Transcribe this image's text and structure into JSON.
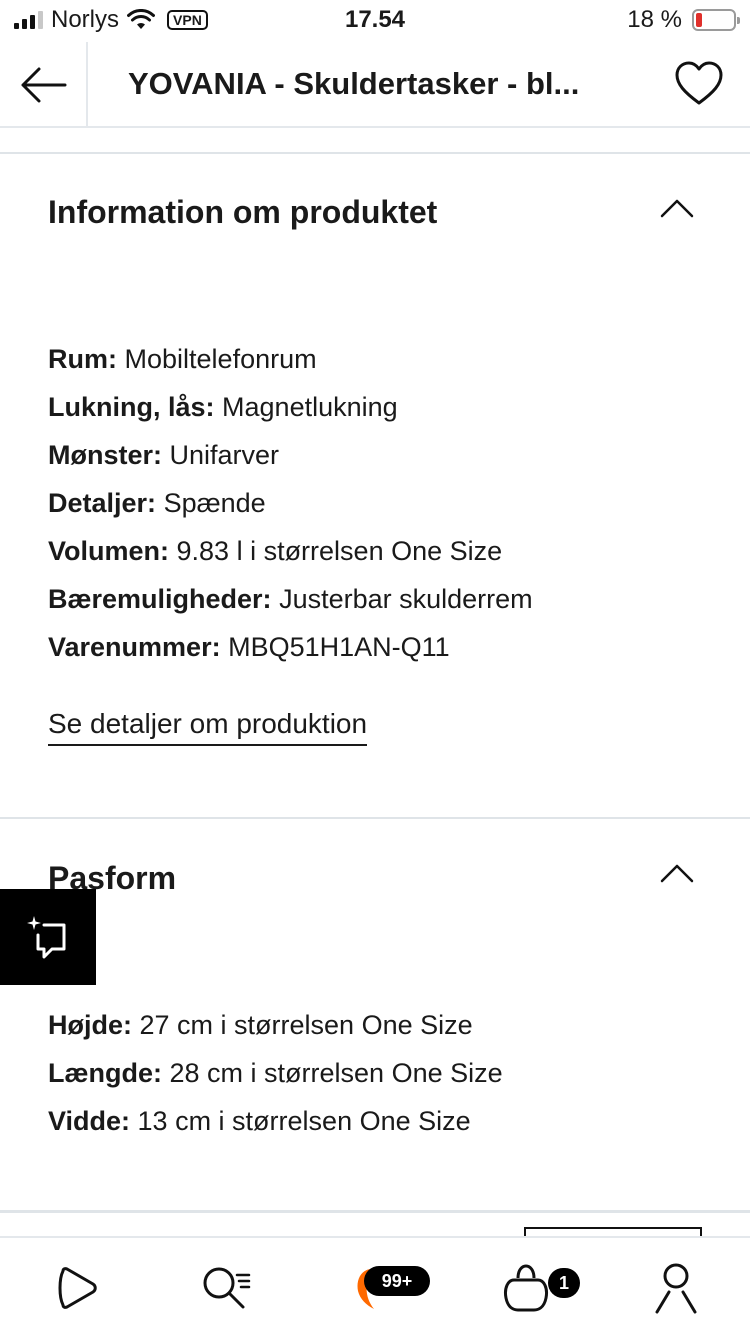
{
  "status_bar": {
    "carrier": "Norlys",
    "vpn": "VPN",
    "time": "17.54",
    "battery_percent": "18 %",
    "battery_level": 0.18,
    "battery_color": "#e0302b"
  },
  "header": {
    "title": "YOVANIA - Skuldertasker - bl...",
    "back_icon": "arrow-left-icon",
    "favorite_icon": "heart-icon"
  },
  "product_info": {
    "title": "Information om produktet",
    "attributes": [
      {
        "key": "Rum:",
        "value": "Mobiltelefonrum"
      },
      {
        "key": "Lukning, lås:",
        "value": "Magnetlukning"
      },
      {
        "key": "Mønster:",
        "value": "Unifarver"
      },
      {
        "key": "Detaljer:",
        "value": "Spænde"
      },
      {
        "key": "Volumen:",
        "value": "9.83 l i størrelsen One Size"
      },
      {
        "key": "Bæremuligheder:",
        "value": "Justerbar skulderrem"
      },
      {
        "key": "Varenummer:",
        "value": "MBQ51H1AN-Q11"
      }
    ],
    "link": "Se detaljer om produktion"
  },
  "fit": {
    "title": "Pasform",
    "attributes": [
      {
        "key": "Højde:",
        "value": "27 cm i størrelsen One Size"
      },
      {
        "key": "Længde:",
        "value": "28 cm i størrelsen One Size"
      },
      {
        "key": "Vidde:",
        "value": "13 cm i størrelsen One Size"
      }
    ]
  },
  "bottom_nav": {
    "items": [
      {
        "icon": "home-play-icon"
      },
      {
        "icon": "search-list-icon"
      },
      {
        "icon": "offers-tag-icon",
        "badge": "99+"
      },
      {
        "icon": "bag-icon",
        "badge": "1"
      },
      {
        "icon": "profile-icon"
      }
    ]
  },
  "colors": {
    "accent": "#ff6900",
    "text": "#1a1a1a",
    "divider": "#dfe4e8"
  }
}
